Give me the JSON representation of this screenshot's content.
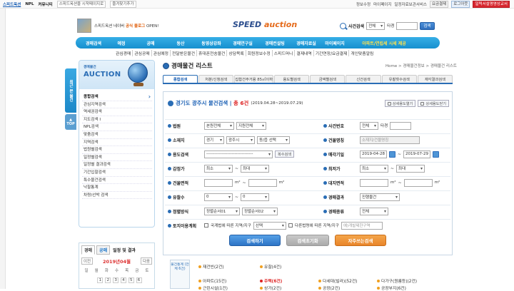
{
  "topbar": {
    "left": [
      "스피드옥션",
      "NPL",
      "커뮤니티",
      "스피드옥션을 시작페이지로",
      "즐겨찾기추가"
    ],
    "right": [
      "정보수정",
      "마이페이지",
      "일정자료보관서비스",
      "요금결제",
      "로그아웃",
      "일력서설명영상교서"
    ]
  },
  "header": {
    "blog_text_pre": "스피드옥션 네이버",
    "blog_highlight": "공식 블로그",
    "blog_text_post": "OPEN!",
    "logo_main": "SPEED",
    "logo_sub": "auction",
    "search_label": "사건검색",
    "search_select": "전체",
    "search_tag": "타경",
    "search_button": "검색"
  },
  "mainnav": [
    "경매검색",
    "예정",
    "공매",
    "동산",
    "동영상강좌",
    "경매연구실",
    "경매컨설팅",
    "경매자료실",
    "마이페이지",
    "아파트/연립세 시세 제공"
  ],
  "subnav": [
    "관심경매",
    "관심공매",
    "관심예정",
    "전달받은물건",
    "휴대폰전송물건",
    "상담목록",
    "회원정보수정",
    "스피드머니",
    "결제내역",
    "기간연장/요금결제",
    "개인맞춤알림"
  ],
  "sidebar": {
    "vertical_tab": "최근 본 물건",
    "top_tab": "TOP",
    "banner_small": "경매물건",
    "banner_big": "AUCTION",
    "menu": [
      "종합검색",
      "관심지역검색",
      "역세권검색",
      "지도검색 I",
      "NPL검색",
      "맞춤검색",
      "지역검색",
      "법원별검색",
      "일정별검색",
      "일정별 결과검색",
      "기간입찰검색",
      "특수물건검색",
      "낙찰통계",
      "차량/선박 검색"
    ]
  },
  "calendar": {
    "tab1": "경매",
    "tab2": "공매",
    "tab3": "일정 및 결과",
    "prev": "이전",
    "next": "다음",
    "month": "2019년04월",
    "week": [
      "일",
      "월",
      "화",
      "수",
      "목",
      "금",
      "토"
    ],
    "days": [
      "1",
      "2",
      "3",
      "4",
      "5",
      "6"
    ]
  },
  "content": {
    "title": "경매물건 리스트",
    "breadcrumb": "Home > 경매물건정보 > 경매물건 리스트",
    "tabs": [
      "종합검색",
      "처분/신청검색",
      "집합건주거용 85㎡이하",
      "용도별검색",
      "금액별검색",
      "신건검색",
      "유찰횟수검색",
      "재각결과검색"
    ],
    "form_title_pre": "경기도 광주시 물건검색",
    "form_title_count": "총 6건",
    "form_daterange": "(2019.04.28~2019.07.29)",
    "btn_detail1": "상세용도열기",
    "btn_detail2": "상세용도닫기",
    "fields": {
      "court": {
        "label": "법원",
        "sel1": "본원전체",
        "sel2": "지원전체"
      },
      "case_no": {
        "label": "사건번호",
        "sel": "전체",
        "tag": "타경"
      },
      "location": {
        "label": "소재지",
        "sel1": "경기",
        "sel2": "광주시",
        "sel3": "동/읍 선택"
      },
      "building": {
        "label": "건물명칭",
        "placeholder": "소재지/건물명칭"
      },
      "usage": {
        "label": "용도검색",
        "sel": "---------------------------------",
        "button": "복수검색"
      },
      "sale_date": {
        "label": "매각기일",
        "from": "2019-04-28",
        "to": "2019-07-29"
      },
      "appraisal": {
        "label": "감정가",
        "sel1": "최소",
        "sel2": "최대"
      },
      "min_price": {
        "label": "최저가",
        "sel1": "최소",
        "sel2": "최대"
      },
      "bld_area": {
        "label": "건물면적",
        "unit": "m²"
      },
      "land_area": {
        "label": "대지면적",
        "unit": "m²"
      },
      "failed": {
        "label": "유찰수",
        "sel1": "0",
        "sel2": "0"
      },
      "result": {
        "label": "경매결과",
        "sel": "진행물건"
      },
      "sort": {
        "label": "정렬방식",
        "sel1": "정렬순서01",
        "sel2": "정렬순서02"
      },
      "auction_type": {
        "label": "경매종류",
        "sel": "전체"
      },
      "land_plan": {
        "label": "토지이용계획",
        "text1": "국계법에 따른 지역/지구",
        "sel": "선택",
        "text2": "다른법령에 따른 지역/지구",
        "placeholder": "예)개발제한구역"
      }
    },
    "btn_search": "검색하기",
    "btn_reset": "검색초기화",
    "btn_fav": "자주쓰는검색"
  },
  "stats": {
    "label": "물건통계 (전체 6건)",
    "items_row1": [
      "재건빈(2건)",
      "유찰(4건)"
    ],
    "items_row2": [
      "아파트(15건)",
      "주택(6건)",
      "다세대(빌라)(52건)",
      "다가구(원룸등)(2건)"
    ],
    "items_row3": [
      "근린시설(1건)",
      "상가(2건)",
      "공장(2건)",
      "공장부지(6건)"
    ]
  }
}
